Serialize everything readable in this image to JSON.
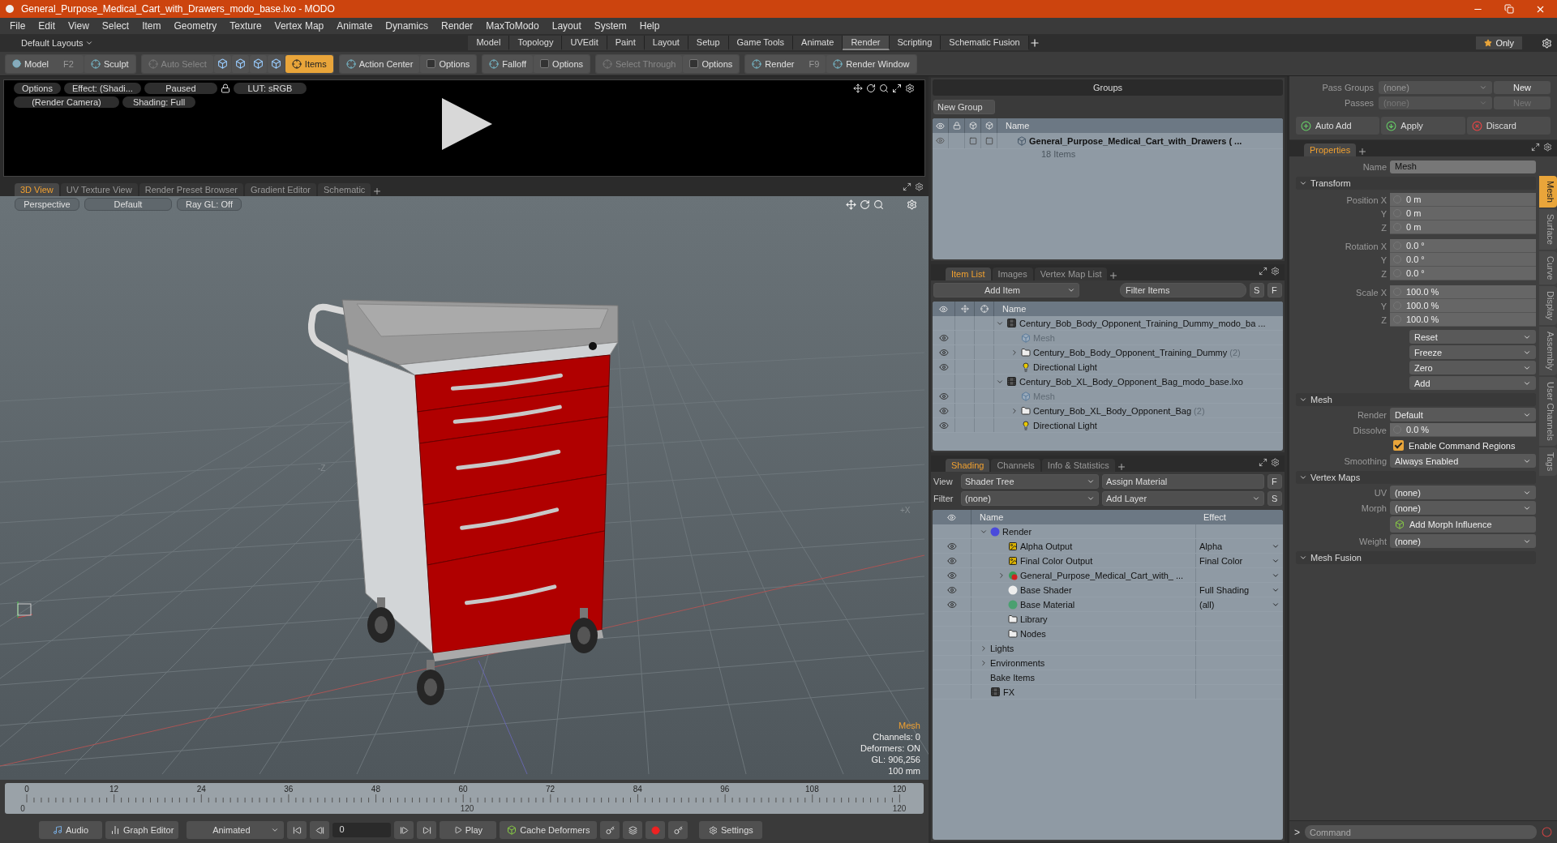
{
  "window": {
    "title": "General_Purpose_Medical_Cart_with_Drawers_modo_base.lxo - MODO"
  },
  "menu": [
    "File",
    "Edit",
    "View",
    "Select",
    "Item",
    "Geometry",
    "Texture",
    "Vertex Map",
    "Animate",
    "Dynamics",
    "Render",
    "MaxToModo",
    "Layout",
    "System",
    "Help"
  ],
  "layout_bar": {
    "preset": "Default Layouts",
    "only": "Only",
    "tabs": [
      {
        "label": "Model",
        "selected": false
      },
      {
        "label": "Topology",
        "selected": false
      },
      {
        "label": "UVEdit",
        "selected": false
      },
      {
        "label": "Paint",
        "selected": false
      },
      {
        "label": "Layout",
        "selected": false
      },
      {
        "label": "Setup",
        "selected": false
      },
      {
        "label": "Game Tools",
        "selected": false
      },
      {
        "label": "Animate",
        "selected": false
      },
      {
        "label": "Render",
        "selected": true
      },
      {
        "label": "Scripting",
        "selected": false
      },
      {
        "label": "Schematic Fusion",
        "selected": false
      }
    ]
  },
  "toolbar": [
    [
      {
        "kind": "mode",
        "label": "Model",
        "shortcut": "F2",
        "active": false,
        "disabled": false
      },
      {
        "kind": "icon",
        "label": "Sculpt",
        "active": false,
        "disabled": false
      }
    ],
    [
      {
        "kind": "icon",
        "label": "Auto Select",
        "active": false,
        "disabled": true
      },
      {
        "kind": "tool",
        "active": false,
        "disabled": false
      },
      {
        "kind": "tool",
        "active": false,
        "disabled": false
      },
      {
        "kind": "tool",
        "active": false,
        "disabled": false
      },
      {
        "kind": "tool",
        "active": false,
        "disabled": false
      },
      {
        "kind": "icon",
        "label": "Items",
        "active": true,
        "disabled": false
      }
    ],
    [
      {
        "kind": "icon",
        "label": "Action Center",
        "active": false,
        "disabled": false
      },
      {
        "kind": "check",
        "label": "Options",
        "active": false,
        "disabled": false
      }
    ],
    [
      {
        "kind": "icon",
        "label": "Falloff",
        "active": false,
        "disabled": false
      },
      {
        "kind": "check",
        "label": "Options",
        "active": false,
        "disabled": false
      }
    ],
    [
      {
        "kind": "icon",
        "label": "Select Through",
        "active": false,
        "disabled": true
      },
      {
        "kind": "check",
        "label": "Options",
        "active": false,
        "disabled": false
      }
    ],
    [
      {
        "kind": "icon",
        "label": "Render",
        "shortcut": "F9",
        "active": false,
        "disabled": false
      },
      {
        "kind": "icon",
        "label": "Render Window",
        "active": false,
        "disabled": false
      }
    ]
  ],
  "preview": {
    "options": "Options",
    "effect": "Effect: (Shadi...",
    "state": "Paused",
    "lut": "LUT: sRGB",
    "camera": "(Render Camera)",
    "shading": "Shading: Full"
  },
  "viewport": {
    "tabs": [
      {
        "label": "3D View",
        "selected": true
      },
      {
        "label": "UV Texture View",
        "selected": false
      },
      {
        "label": "Render Preset Browser",
        "selected": false
      },
      {
        "label": "Gradient Editor",
        "selected": false
      },
      {
        "label": "Schematic",
        "selected": false
      }
    ],
    "buttons": [
      "Perspective",
      "Default",
      "Ray GL: Off"
    ],
    "axis_labels": [
      "-Z",
      "+X"
    ],
    "info_title": "Mesh",
    "info": [
      "Channels: 0",
      "Deformers: ON",
      "GL: 906,256",
      "100 mm"
    ]
  },
  "timeline": {
    "ticks": [
      "0",
      "12",
      "24",
      "36",
      "48",
      "60",
      "72",
      "84",
      "96",
      "108",
      "120"
    ],
    "range": [
      "0",
      "120",
      "120"
    ]
  },
  "bottom_bar": {
    "audio": "Audio",
    "graph_editor": "Graph Editor",
    "mode": "Animated",
    "frame": "0",
    "play": "Play",
    "cache": "Cache Deformers",
    "settings": "Settings"
  },
  "groups": {
    "title": "Groups",
    "new_group": "New Group",
    "column": "Name",
    "rows": [
      {
        "name": "General_Purpose_Medical_Cart_with_Drawers ( ...",
        "count": "18 Items"
      }
    ]
  },
  "item_list": {
    "tabs": [
      {
        "label": "Item List",
        "selected": true
      },
      {
        "label": "Images",
        "selected": false
      },
      {
        "label": "Vertex Map List",
        "selected": false
      }
    ],
    "add_item": "Add Item",
    "filter": {
      "placeholder": "Filter Items"
    },
    "buttons": [
      "S",
      "F"
    ],
    "column": "Name",
    "items": [
      {
        "name": "Century_Bob_Body_Opponent_Training_Dummy_modo_ba ...",
        "kind": "scene",
        "visible": false,
        "expanded": true,
        "children": [
          {
            "name": "Mesh",
            "kind": "mesh",
            "visible": true
          },
          {
            "name": "Century_Bob_Body_Opponent_Training_Dummy",
            "count": "(2)",
            "kind": "group",
            "visible": true,
            "expanded": false
          },
          {
            "name": "Directional Light",
            "kind": "light",
            "visible": true
          }
        ]
      },
      {
        "name": "Century_Bob_XL_Body_Opponent_Bag_modo_base.lxo",
        "kind": "scene",
        "visible": false,
        "expanded": true,
        "children": [
          {
            "name": "Mesh",
            "kind": "mesh",
            "visible": true
          },
          {
            "name": "Century_Bob_XL_Body_Opponent_Bag",
            "count": "(2)",
            "kind": "group",
            "visible": true,
            "expanded": false
          },
          {
            "name": "Directional Light",
            "kind": "light",
            "visible": true
          }
        ]
      }
    ]
  },
  "shading": {
    "tabs": [
      {
        "label": "Shading",
        "selected": true
      },
      {
        "label": "Channels",
        "selected": false
      },
      {
        "label": "Info & Statistics",
        "selected": false
      }
    ],
    "view_label": "View",
    "view": "Shader Tree",
    "assign": "Assign Material",
    "filter_label": "Filter",
    "filter": "(none)",
    "add_layer": "Add Layer",
    "buttons": [
      "F",
      "S"
    ],
    "columns": [
      "Name",
      "Effect"
    ],
    "items": [
      {
        "name": "Render",
        "kind": "render",
        "visible": false,
        "expanded": true,
        "children": [
          {
            "name": "Alpha Output",
            "effect": "Alpha",
            "kind": "output",
            "visible": true
          },
          {
            "name": "Final Color Output",
            "effect": "Final Color",
            "kind": "output",
            "visible": true
          },
          {
            "name": "General_Purpose_Medical_Cart_with_ ...",
            "kind": "material-group",
            "visible": true,
            "expanded": false
          },
          {
            "name": "Base Shader",
            "effect": "Full Shading",
            "kind": "shader",
            "visible": true
          },
          {
            "name": "Base Material",
            "effect": "(all)",
            "kind": "material",
            "visible": true
          },
          {
            "name": "Library",
            "kind": "folder",
            "visible": false
          },
          {
            "name": "Nodes",
            "kind": "folder",
            "visible": false
          }
        ]
      },
      {
        "name": "Lights",
        "kind": "plain",
        "visible": false,
        "expanded": false
      },
      {
        "name": "Environments",
        "kind": "plain",
        "visible": false,
        "expanded": false
      },
      {
        "name": "Bake Items",
        "kind": "plain",
        "visible": false
      },
      {
        "name": "FX",
        "kind": "fx",
        "visible": false
      }
    ]
  },
  "passes": {
    "rows": [
      {
        "label": "Pass Groups",
        "value": "(none)",
        "button": "New",
        "disabled": false
      },
      {
        "label": "Passes",
        "value": "(none)",
        "button": "New",
        "disabled": true
      }
    ],
    "auto_add": "Auto Add",
    "apply": "Apply",
    "discard": "Discard"
  },
  "properties": {
    "tabs": [
      {
        "label": "Properties",
        "selected": true
      }
    ],
    "name_label": "Name",
    "name": "Mesh",
    "sections": [
      {
        "title": "Transform",
        "rows": [
          {
            "kind": "vector",
            "rows": [
              {
                "label": "Position X",
                "value": "0 m"
              },
              {
                "label": "Y",
                "value": "0 m"
              },
              {
                "label": "Z",
                "value": "0 m"
              }
            ]
          },
          {
            "kind": "vector",
            "rows": [
              {
                "label": "Rotation X",
                "value": "0.0 °"
              },
              {
                "label": "Y",
                "value": "0.0 °"
              },
              {
                "label": "Z",
                "value": "0.0 °"
              }
            ]
          },
          {
            "kind": "vector",
            "rows": [
              {
                "label": "Scale X",
                "value": "100.0 %"
              },
              {
                "label": "Y",
                "value": "100.0 %"
              },
              {
                "label": "Z",
                "value": "100.0 %"
              }
            ]
          },
          {
            "kind": "menu",
            "label": "Reset"
          },
          {
            "kind": "menu",
            "label": "Freeze"
          },
          {
            "kind": "menu",
            "label": "Zero"
          },
          {
            "kind": "menu",
            "label": "Add"
          }
        ]
      },
      {
        "title": "Mesh",
        "rows": [
          {
            "kind": "dropdown",
            "label": "Render",
            "value": "Default"
          },
          {
            "kind": "field",
            "label": "Dissolve",
            "value": "0.0 %"
          },
          {
            "kind": "check",
            "label": "Enable Command Regions",
            "checked": true
          },
          {
            "kind": "dropdown",
            "label": "Smoothing",
            "value": "Always Enabled"
          }
        ]
      },
      {
        "title": "Vertex Maps",
        "rows": [
          {
            "kind": "dropdown",
            "label": "UV",
            "value": "(none)"
          },
          {
            "kind": "dropdown",
            "label": "Morph",
            "value": "(none)"
          },
          {
            "kind": "button",
            "label": "Add Morph Influence"
          },
          {
            "kind": "dropdown",
            "label": "Weight",
            "value": "(none)"
          }
        ]
      },
      {
        "title": "Mesh Fusion"
      }
    ],
    "side_tabs": [
      {
        "label": "Mesh",
        "selected": true
      },
      {
        "label": "Surface",
        "selected": false
      },
      {
        "label": "Curve",
        "selected": false
      },
      {
        "label": "Display",
        "selected": false
      },
      {
        "label": "Assembly",
        "selected": false
      },
      {
        "label": "User Channels",
        "selected": false
      },
      {
        "label": "Tags",
        "selected": false
      }
    ]
  },
  "command": {
    "prompt": ">",
    "placeholder": "Command"
  }
}
